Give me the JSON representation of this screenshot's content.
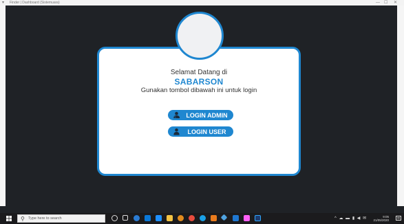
{
  "window": {
    "title": "Finder | Dashboard (Sistemuara)",
    "minimize": "—",
    "maximize": "☐",
    "close": "✕"
  },
  "login": {
    "welcome": "Selamat Datang di",
    "brand": "SABARSON",
    "subtitle": "Gunakan tombol dibawah ini untuk login",
    "admin_button": "LOGIN ADMIN",
    "user_button": "LOGIN USER",
    "accent_color": "#1f87d0"
  },
  "taskbar": {
    "search_placeholder": "Type here to search",
    "time": "9:05",
    "date": "21/05/2020",
    "apps": [
      "task-view",
      "edge",
      "store",
      "mail",
      "explorer",
      "photos",
      "chrome",
      "firefox",
      "security",
      "app-red",
      "vscode",
      "adobe-xd",
      "photoshop"
    ]
  }
}
